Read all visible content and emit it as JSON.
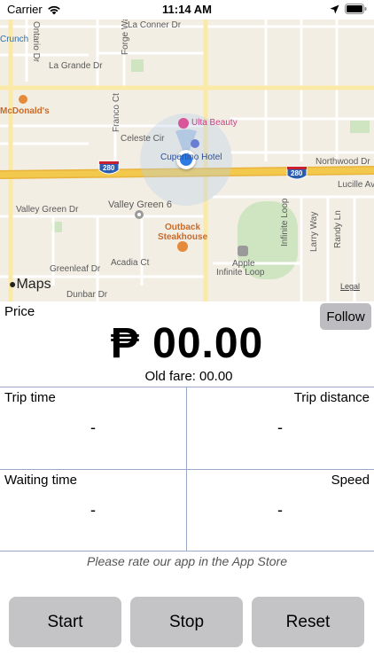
{
  "status_bar": {
    "carrier": "Carrier",
    "time": "11:14 AM"
  },
  "map": {
    "labels": {
      "la_conner": "La Conner Dr",
      "la_grande": "La Grande Dr",
      "crunch": "Crunch",
      "mcdonalds": "McDonald's",
      "ontario": "Ontario Dr",
      "forge_way": "Forge Way",
      "franco_ct": "Franco Ct",
      "celeste_cir": "Celeste Cir",
      "ulta": "Ulta Beauty",
      "hotel": "Cupertino Hotel",
      "northwood": "Northwood Dr",
      "lucille": "Lucille Ave",
      "valley_green_dr": "Valley Green Dr",
      "valley_green_6": "Valley Green 6",
      "outback_1": "Outback",
      "outback_2": "Steakhouse",
      "acadia": "Acadia Ct",
      "greenleaf": "Greenleaf Dr",
      "dunbar": "Dunbar Dr",
      "apple_1": "Apple",
      "apple_2": "Infinite Loop",
      "infinite_loop": "Infinite Loop",
      "larry_way": "Larry Way",
      "randy_ln": "Randy Ln",
      "highway": "280",
      "maps_logo": "Maps",
      "legal": "Legal"
    }
  },
  "price": {
    "label": "Price",
    "follow_button": "Follow",
    "value": "₱ 00.00",
    "old_fare_label": "Old fare:",
    "old_fare_value": "00.00"
  },
  "stats": {
    "trip_time_label": "Trip time",
    "trip_time_value": "-",
    "trip_distance_label": "Trip distance",
    "trip_distance_value": "-",
    "waiting_time_label": "Waiting time",
    "waiting_time_value": "-",
    "speed_label": "Speed",
    "speed_value": "-"
  },
  "rate_text": "Please rate our app in the App Store",
  "buttons": {
    "start": "Start",
    "stop": "Stop",
    "reset": "Reset"
  },
  "colors": {
    "button_bg": "#c4c4c7",
    "grid_line": "#9aa9c7",
    "user_location": "#2d7be4",
    "highway": "#f2c94c"
  }
}
